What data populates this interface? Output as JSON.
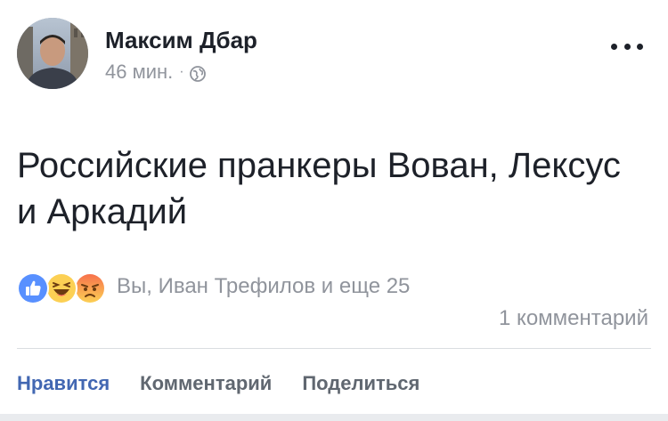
{
  "post": {
    "author": {
      "name": "Максим Дбар",
      "avatar_icon": "profile-photo"
    },
    "meta": {
      "time": "46 мин.",
      "separator": "·",
      "privacy_icon": "globe-icon"
    },
    "menu_icon": "more-horizontal-icon",
    "text": "Российские пранкеры Вован, Лексус и Аркадий",
    "reactions": {
      "icons": [
        "like-icon",
        "haha-icon",
        "angry-icon"
      ],
      "summary": "Вы, Иван Трефилов и еще 25"
    },
    "comments": "1 комментарий"
  },
  "actions": {
    "like_label": "Нравится",
    "comment_label": "Комментарий",
    "share_label": "Поделиться"
  },
  "colors": {
    "text": "#1d2129",
    "secondary": "#90949c",
    "accent": "#4267b2",
    "action": "#606770",
    "like": "#5890ff",
    "haha": "#fcd054",
    "angry": "#f7714c"
  }
}
